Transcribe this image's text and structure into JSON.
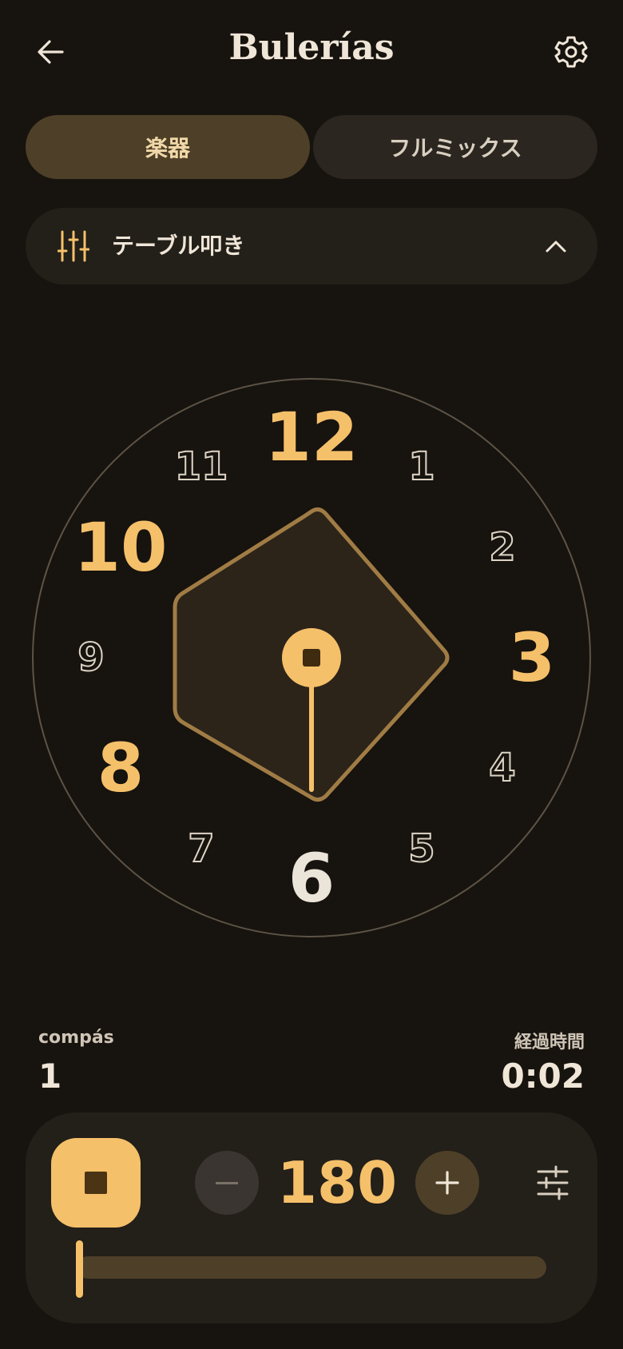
{
  "header": {
    "title": "Bulerías",
    "back_icon": "arrow-left-icon",
    "settings_icon": "gear-icon"
  },
  "tabs": [
    {
      "label": "楽器",
      "active": true
    },
    {
      "label": "フルミックス",
      "active": false
    }
  ],
  "selector": {
    "label": "テーブル叩き",
    "icon": "sliders-icon",
    "chevron": "chevron-up-icon",
    "expanded": true
  },
  "clock": {
    "numbers": [
      {
        "n": "12",
        "accent": true
      },
      {
        "n": "1",
        "accent": false
      },
      {
        "n": "2",
        "accent": false
      },
      {
        "n": "3",
        "accent": true
      },
      {
        "n": "4",
        "accent": false
      },
      {
        "n": "5",
        "accent": false
      },
      {
        "n": "6",
        "accent": false,
        "current": true
      },
      {
        "n": "7",
        "accent": false
      },
      {
        "n": "8",
        "accent": true
      },
      {
        "n": "9",
        "accent": false
      },
      {
        "n": "10",
        "accent": true
      },
      {
        "n": "11",
        "accent": false
      }
    ],
    "hand_at": 6
  },
  "stats": {
    "compas_label": "compás",
    "compas_value": "1",
    "elapsed_label": "経過時間",
    "elapsed_value": "0:02"
  },
  "controls": {
    "bpm": "180",
    "stop_icon": "stop-icon",
    "minus_icon": "minus-icon",
    "plus_icon": "plus-icon",
    "tune_icon": "tune-icon",
    "progress": 0.0
  },
  "colors": {
    "background": "#17130e",
    "accent": "#f5c06a",
    "accent_dim": "#4e4028",
    "panel": "#231f19",
    "text": "#efe6d8"
  }
}
